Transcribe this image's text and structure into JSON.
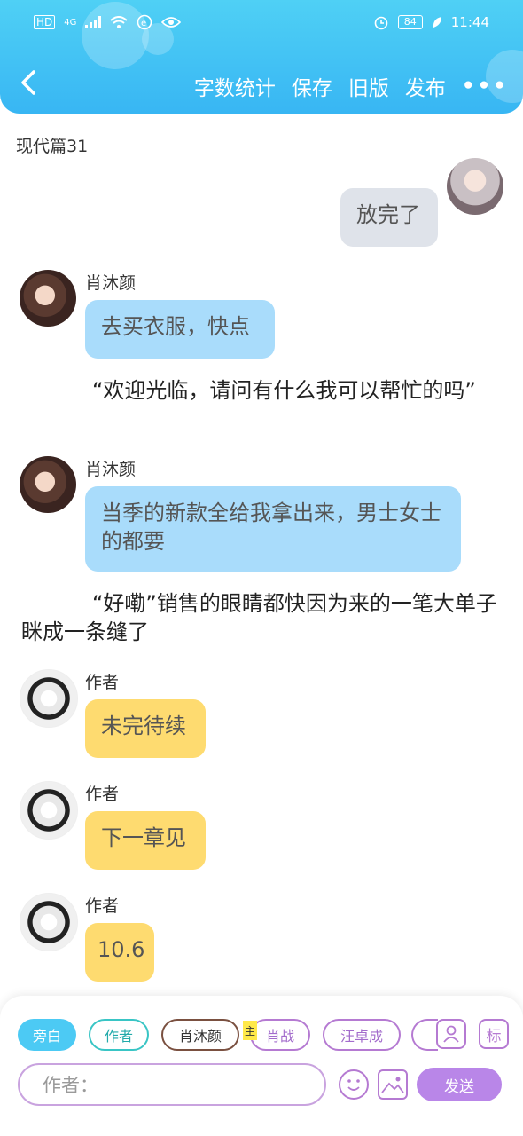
{
  "status_bar": {
    "left_icons": [
      "HD",
      "4G",
      "signal-icon",
      "wifi-icon",
      "notification-icon",
      "eye-icon"
    ],
    "alarm_icon": "alarm-icon",
    "battery": "84",
    "leaf_icon": "leaf-icon",
    "time": "11:44"
  },
  "header": {
    "back_icon": "chevron-left-icon",
    "actions": [
      "字数统计",
      "保存",
      "旧版",
      "发布"
    ],
    "more": "•••"
  },
  "chapter_title": "现代篇31",
  "messages": [
    {
      "type": "right",
      "text": "放完了"
    },
    {
      "type": "left",
      "name": "肖沐颜",
      "text": "去买衣服，快点"
    },
    {
      "type": "narration",
      "text": "“欢迎光临，请问有什么我可以帮忙的吗”"
    },
    {
      "type": "left",
      "name": "肖沐颜",
      "text": "当季的新款全给我拿出来，男士女士的都要"
    },
    {
      "type": "narration",
      "text": "“好嘞”销售的眼睛都快因为来的一笔大单子眯成一条缝了"
    },
    {
      "type": "left",
      "name": "作者",
      "text": "未完待续"
    },
    {
      "type": "left",
      "name": "作者",
      "text": "下一章见"
    },
    {
      "type": "left",
      "name": "作者",
      "text": "10.6"
    }
  ],
  "bottom": {
    "chips": [
      "旁白",
      "作者",
      "肖沐颜",
      "肖战",
      "汪卓成"
    ],
    "sticker": "主",
    "right_buttons": [
      "user-card-icon",
      "标"
    ],
    "input_placeholder": "作者：",
    "emoji_icon": "emoji-icon",
    "image_icon": "image-icon",
    "send": "发送"
  },
  "colors": {
    "header": "#38b6f3",
    "blue_bubble": "#a9dcfb",
    "gray_bubble": "#dfe3ea",
    "yellow_bubble": "#fedb70",
    "accent_purple": "#b57ad2",
    "send_button": "#b986e8"
  }
}
